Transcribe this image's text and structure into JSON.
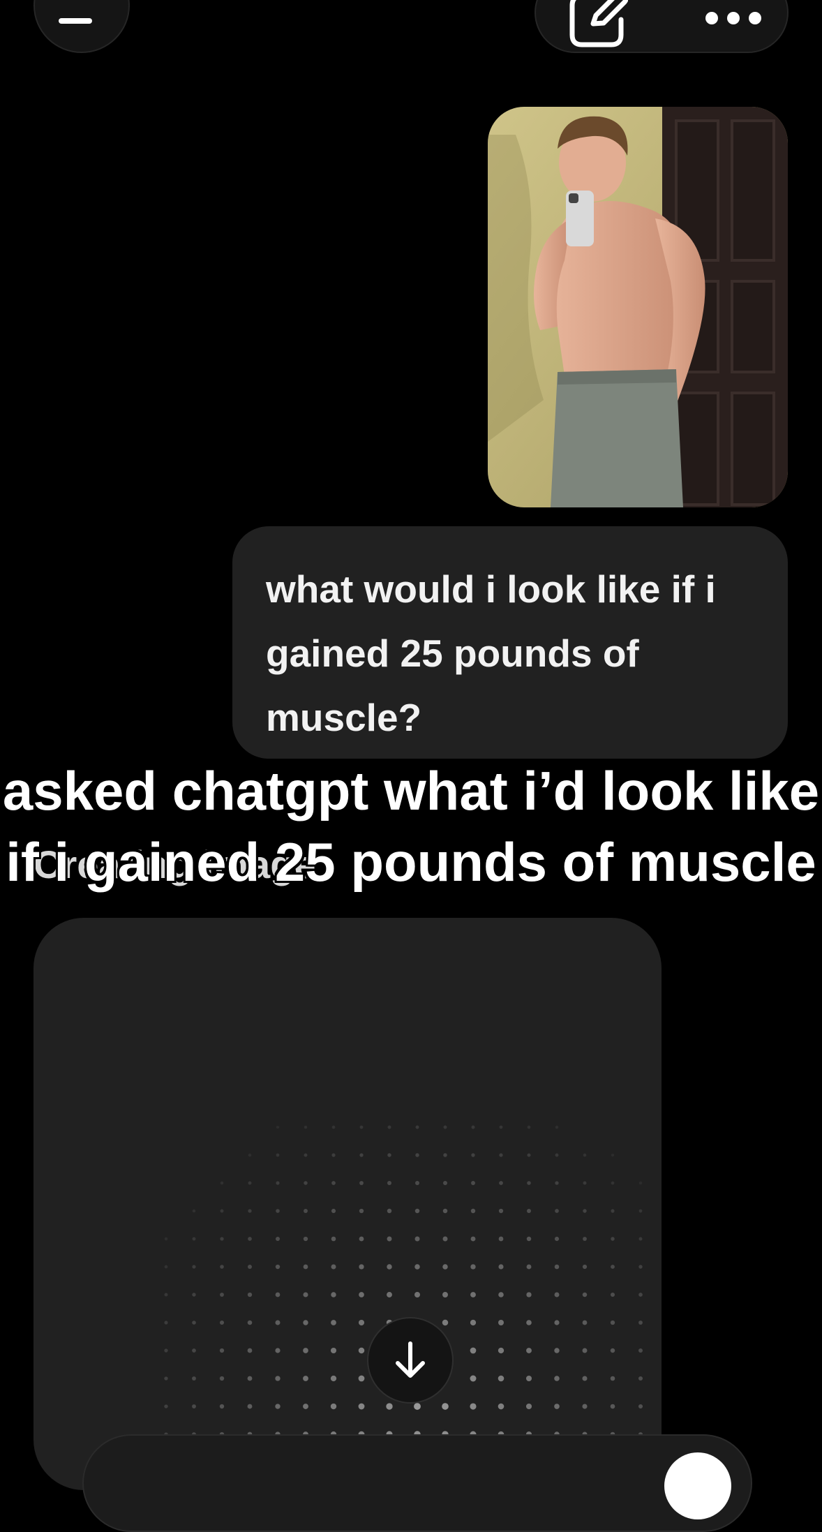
{
  "header": {
    "menu_icon": "menu-icon",
    "edit_icon": "compose-icon",
    "more_icon": "more-dots-icon"
  },
  "conversation": {
    "user_message": {
      "attachment_icon": "photo-thumbnail",
      "text": "what would i look like if i gained 25 pounds of muscle?"
    },
    "assistant_status": "Creating image",
    "image_placeholder": {
      "state": "loading"
    }
  },
  "overlay": {
    "caption": "asked chatgpt what i’d look like if i gained 25 pounds of muscle"
  },
  "controls": {
    "scroll_down_icon": "arrow-down-icon",
    "composer_send_icon": "send-button-circle"
  },
  "colors": {
    "background": "#000000",
    "bubble": "#212121",
    "card": "#212121",
    "text": "#ffffff",
    "muted_text": "#d8d8d8"
  }
}
